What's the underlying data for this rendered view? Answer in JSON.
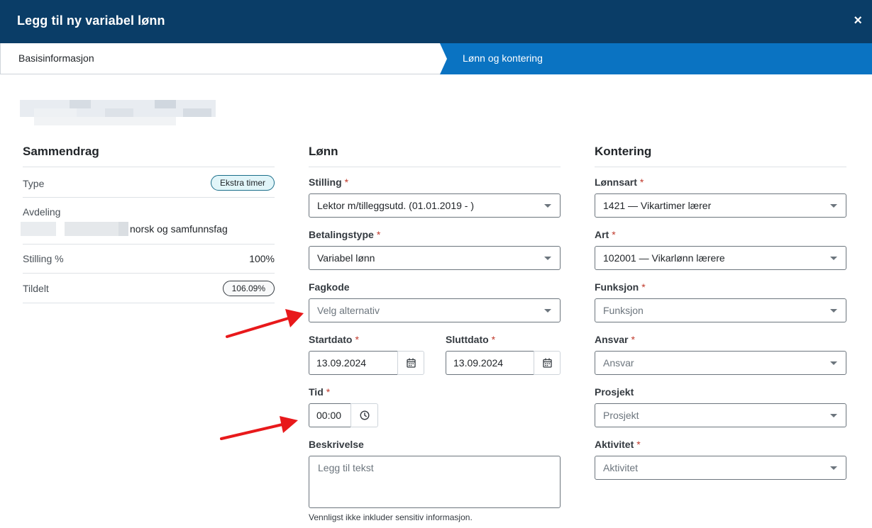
{
  "modal": {
    "title": "Legg til ny variabel lønn",
    "close": "×"
  },
  "steps": [
    {
      "label": "Basisinformasjon",
      "active": false
    },
    {
      "label": "Lønn og kontering",
      "active": true
    }
  ],
  "summary": {
    "heading": "Sammendrag",
    "type_label": "Type",
    "type_value": "Ekstra timer",
    "avdeling_label": "Avdeling",
    "avdeling_value": "norsk og samfunnsfag",
    "stilling_label": "Stilling %",
    "stilling_value": "100%",
    "tildelt_label": "Tildelt",
    "tildelt_value": "106.09%"
  },
  "lonn": {
    "heading": "Lønn",
    "required_mark": "*",
    "stilling_label": "Stilling",
    "stilling_value": "Lektor m/tilleggsutd. (01.01.2019 - )",
    "betalingstype_label": "Betalingstype",
    "betalingstype_value": "Variabel lønn",
    "fagkode_label": "Fagkode",
    "fagkode_placeholder": "Velg alternativ",
    "startdato_label": "Startdato",
    "startdato_value": "13.09.2024",
    "sluttdato_label": "Sluttdato",
    "sluttdato_value": "13.09.2024",
    "tid_label": "Tid",
    "tid_value": "00:00",
    "beskrivelse_label": "Beskrivelse",
    "beskrivelse_placeholder": "Legg til tekst",
    "beskrivelse_hint": "Vennligst ikke inkluder sensitiv informasjon."
  },
  "kontering": {
    "heading": "Kontering",
    "lonnsart_label": "Lønnsart",
    "lonnsart_value": "1421 — Vikartimer lærer",
    "art_label": "Art",
    "art_value": "102001 — Vikarlønn lærere",
    "funksjon_label": "Funksjon",
    "funksjon_placeholder": "Funksjon",
    "ansvar_label": "Ansvar",
    "ansvar_placeholder": "Ansvar",
    "prosjekt_label": "Prosjekt",
    "prosjekt_placeholder": "Prosjekt",
    "aktivitet_label": "Aktivitet",
    "aktivitet_placeholder": "Aktivitet"
  },
  "colors": {
    "header": "#0a3d67",
    "active_step": "#0a73c2",
    "required": "#c0392b",
    "annotation_arrow": "#e8191b"
  }
}
